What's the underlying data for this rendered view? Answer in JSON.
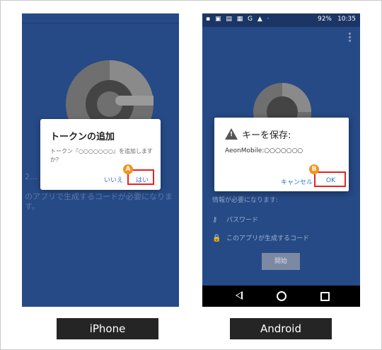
{
  "iphone": {
    "background_text_line1": "2…",
    "background_text_line2": "のアプリで生成するコードが必要になります。",
    "bottom_text": "",
    "dialog": {
      "title": "トークンの追加",
      "body": "トークン『○○○○○○○』を追加しますか？",
      "no_label": "いいえ",
      "yes_label": "はい",
      "marker": "A"
    }
  },
  "android": {
    "status": {
      "icons": "▪ ▣ ▤ ▦ G ▲ ·",
      "battery": "92%",
      "time": "10:35"
    },
    "hint": "情報が必要になります:",
    "password_label": "パスワード",
    "code_label": "このアプリが生成するコード",
    "start_label": "開始",
    "dialog": {
      "title": "キーを保存:",
      "account": "AeonMobile:○○○○○○○",
      "cancel_label": "キャンセル",
      "ok_label": "OK",
      "marker": "B"
    }
  },
  "captions": {
    "iphone": "iPhone",
    "android": "Android"
  },
  "colors": {
    "screen_bg": "#264a86",
    "highlight": "#e8231f",
    "marker": "#f0951f",
    "caption_bg": "#252525"
  }
}
